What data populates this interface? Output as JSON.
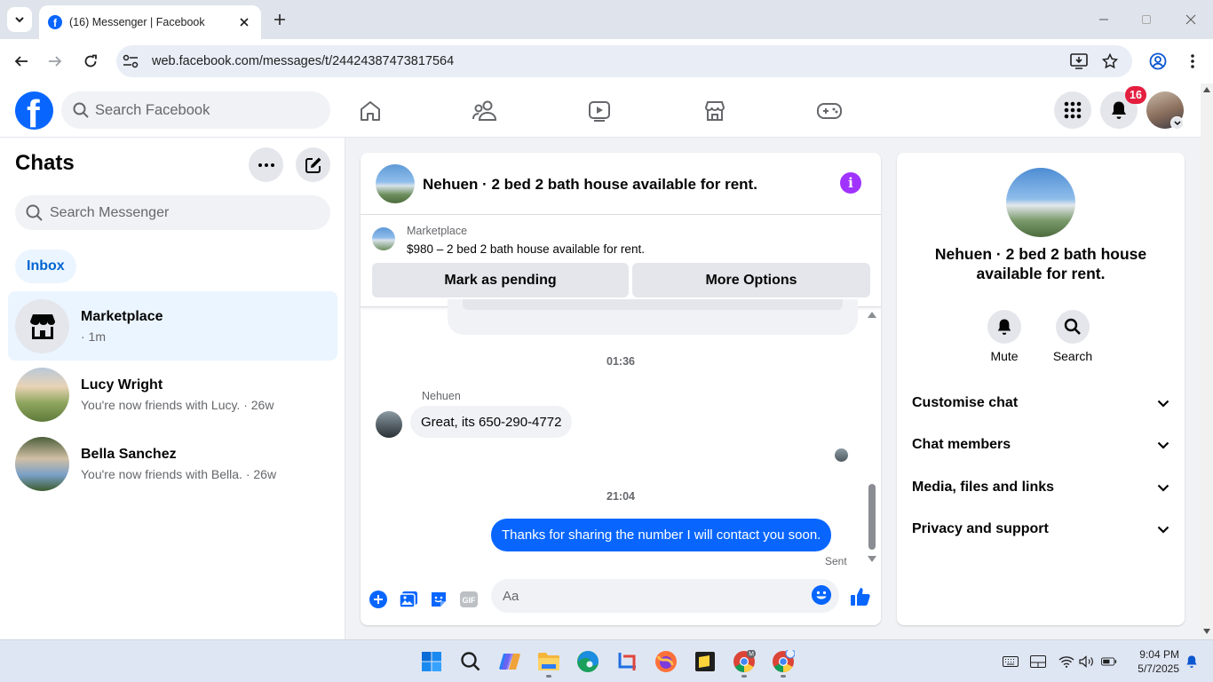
{
  "browser": {
    "tab_title": "(16) Messenger | Facebook",
    "url": "web.facebook.com/messages/t/24424387473817564"
  },
  "fb": {
    "search_placeholder": "Search Facebook",
    "notification_count": "16",
    "brand_color": "#0866ff"
  },
  "sidebar": {
    "title": "Chats",
    "search_placeholder": "Search Messenger",
    "filter": "Inbox",
    "chats": [
      {
        "name": "Marketplace",
        "sub": "· 1m",
        "active": true
      },
      {
        "name": "Lucy Wright",
        "sub": "You're now friends with Lucy. · 26w"
      },
      {
        "name": "Bella Sanchez",
        "sub": "You're now friends with Bella. · 26w"
      }
    ]
  },
  "chat": {
    "title": "Nehuen · 2 bed 2 bath house available for rent.",
    "marketplace_label": "Marketplace",
    "listing": "$980 – 2 bed 2 bath house available for rent.",
    "mark_pending": "Mark as pending",
    "more_options": "More Options",
    "time1": "01:36",
    "sender": "Nehuen",
    "incoming": "Great, its 650-290-4772",
    "time2": "21:04",
    "outgoing": "Thanks for sharing the number I will contact you soon.",
    "status": "Sent",
    "composer_placeholder": "Aa"
  },
  "info": {
    "title": "Nehuen · 2 bed 2 bath house available for rent.",
    "mute": "Mute",
    "search": "Search",
    "rows": [
      "Customise chat",
      "Chat members",
      "Media, files and links",
      "Privacy and support"
    ]
  },
  "taskbar": {
    "time": "9:04 PM",
    "date": "5/7/2025"
  }
}
